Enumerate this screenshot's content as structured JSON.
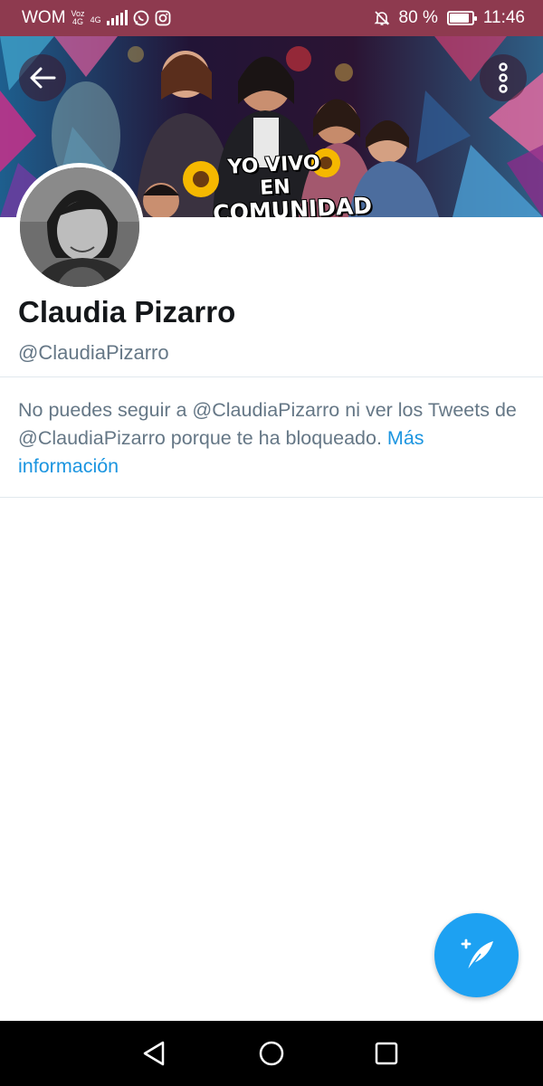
{
  "status_bar": {
    "carrier": "WOM",
    "network_tag_top": "Voz",
    "network_tag_bottom": "4G",
    "signal_tag": "4G",
    "battery": "80 %",
    "battery_level": 0.8,
    "time": "11:46",
    "icons": [
      "signal-bars-icon",
      "whatsapp-icon",
      "instagram-icon",
      "bell-off-icon",
      "battery-saver-icon"
    ]
  },
  "header": {
    "banner_line1": "YO VIVO EN",
    "banner_line2": "COMUNIDAD",
    "back_icon": "arrow-left-icon",
    "more_icon": "more-vertical-icon"
  },
  "profile": {
    "name": "Claudia Pizarro",
    "handle": "@ClaudiaPizarro"
  },
  "blocked_notice": {
    "text": "No puedes seguir a @ClaudiaPizarro ni ver los Tweets de @ClaudiaPizarro porque te ha bloqueado.",
    "link": "Más información"
  },
  "fab": {
    "icon": "compose-tweet-icon"
  },
  "nav_bar": {
    "icons": [
      "back-triangle-icon",
      "home-circle-icon",
      "recents-square-icon"
    ]
  },
  "colors": {
    "status_bar": "#8e3a4f",
    "accent": "#1da1f2",
    "link": "#1b95e0",
    "secondary_text": "#657786",
    "divider": "#e1e8ed"
  }
}
